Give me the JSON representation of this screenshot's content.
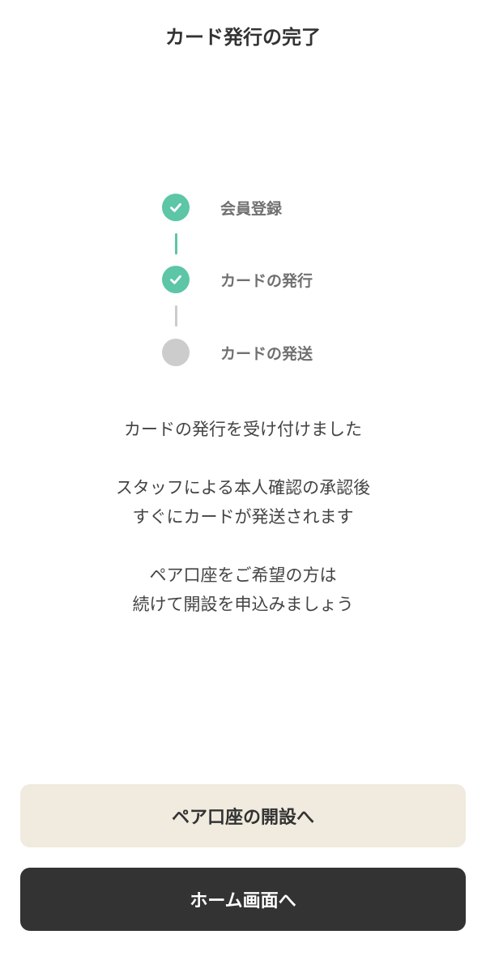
{
  "header": {
    "title": "カード発行の完了"
  },
  "steps": [
    {
      "label": "会員登録",
      "status": "done"
    },
    {
      "label": "カードの発行",
      "status": "done"
    },
    {
      "label": "カードの発送",
      "status": "pending"
    }
  ],
  "messages": {
    "line1": "カードの発行を受け付けました",
    "line2": "スタッフによる本人確認の承認後",
    "line3": "すぐにカードが発送されます",
    "line4": "ペア口座をご希望の方は",
    "line5": "続けて開設を申込みましょう"
  },
  "buttons": {
    "pair_account": "ペア口座の開設へ",
    "home": "ホーム画面へ"
  },
  "colors": {
    "accent": "#5cc6a6",
    "pending": "#cccccc",
    "pair_button_bg": "#f0ebde",
    "home_button_bg": "#333333",
    "home_button_text": "#ffffff"
  }
}
